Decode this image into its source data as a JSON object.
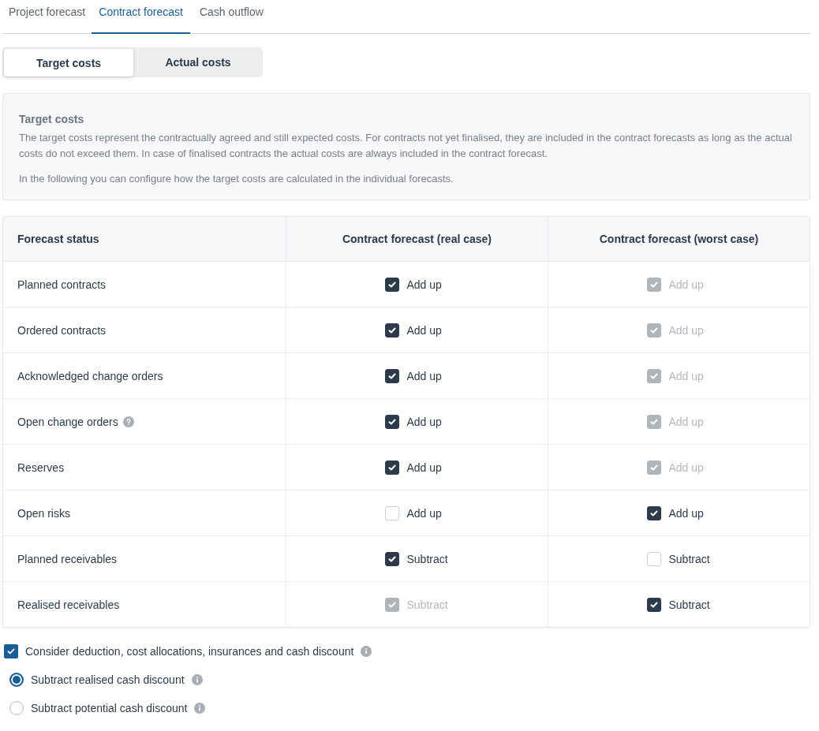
{
  "tabs": [
    {
      "label": "Project forecast",
      "selected": false
    },
    {
      "label": "Contract forecast",
      "selected": true
    },
    {
      "label": "Cash outflow",
      "selected": false
    }
  ],
  "segments": [
    {
      "label": "Target costs",
      "selected": true
    },
    {
      "label": "Actual costs",
      "selected": false
    }
  ],
  "info": {
    "title": "Target costs",
    "paragraphs": [
      "The target costs represent the contractually agreed and still expected costs. For contracts not yet finalised, they are included in the contract forecasts as long as the actual costs do not exceed them. In case of finalised contracts the actual costs are always included in the contract forecast.",
      "In the following you can configure how the target costs are calculated in the individual forecasts."
    ]
  },
  "table": {
    "columns": [
      "Forecast status",
      "Contract forecast (real case)",
      "Contract forecast (worst case)"
    ],
    "rows": [
      {
        "cells": [
          {
            "kind": "label",
            "text": "Planned contracts",
            "help": false
          },
          {
            "kind": "checkbox",
            "text": "Add up",
            "checked": true,
            "disabled": false
          },
          {
            "kind": "checkbox",
            "text": "Add up",
            "checked": true,
            "disabled": true
          }
        ]
      },
      {
        "cells": [
          {
            "kind": "label",
            "text": "Ordered contracts",
            "help": false
          },
          {
            "kind": "checkbox",
            "text": "Add up",
            "checked": true,
            "disabled": false
          },
          {
            "kind": "checkbox",
            "text": "Add up",
            "checked": true,
            "disabled": true
          }
        ]
      },
      {
        "cells": [
          {
            "kind": "label",
            "text": "Acknowledged change orders",
            "help": false
          },
          {
            "kind": "checkbox",
            "text": "Add up",
            "checked": true,
            "disabled": false
          },
          {
            "kind": "checkbox",
            "text": "Add up",
            "checked": true,
            "disabled": true
          }
        ]
      },
      {
        "cells": [
          {
            "kind": "label",
            "text": "Open change orders",
            "help": true
          },
          {
            "kind": "checkbox",
            "text": "Add up",
            "checked": true,
            "disabled": false
          },
          {
            "kind": "checkbox",
            "text": "Add up",
            "checked": true,
            "disabled": true
          }
        ]
      },
      {
        "cells": [
          {
            "kind": "label",
            "text": "Reserves",
            "help": false
          },
          {
            "kind": "checkbox",
            "text": "Add up",
            "checked": true,
            "disabled": false
          },
          {
            "kind": "checkbox",
            "text": "Add up",
            "checked": true,
            "disabled": true
          }
        ]
      },
      {
        "cells": [
          {
            "kind": "label",
            "text": "Open risks",
            "help": false
          },
          {
            "kind": "checkbox",
            "text": "Add up",
            "checked": false,
            "disabled": false
          },
          {
            "kind": "checkbox",
            "text": "Add up",
            "checked": true,
            "disabled": false
          }
        ]
      },
      {
        "cells": [
          {
            "kind": "label",
            "text": "Planned receivables",
            "help": false
          },
          {
            "kind": "checkbox",
            "text": "Subtract",
            "checked": true,
            "disabled": false
          },
          {
            "kind": "checkbox",
            "text": "Subtract",
            "checked": false,
            "disabled": false
          }
        ]
      },
      {
        "cells": [
          {
            "kind": "label",
            "text": "Realised receivables",
            "help": false
          },
          {
            "kind": "checkbox",
            "text": "Subtract",
            "checked": true,
            "disabled": true
          },
          {
            "kind": "checkbox",
            "text": "Subtract",
            "checked": true,
            "disabled": false
          }
        ]
      }
    ]
  },
  "consider": {
    "label": "Consider deduction, cost allocations, insurances and cash discount",
    "checked": true
  },
  "discount_options": [
    {
      "label": "Subtract realised cash discount",
      "selected": true
    },
    {
      "label": "Subtract potential cash discount",
      "selected": false
    }
  ]
}
